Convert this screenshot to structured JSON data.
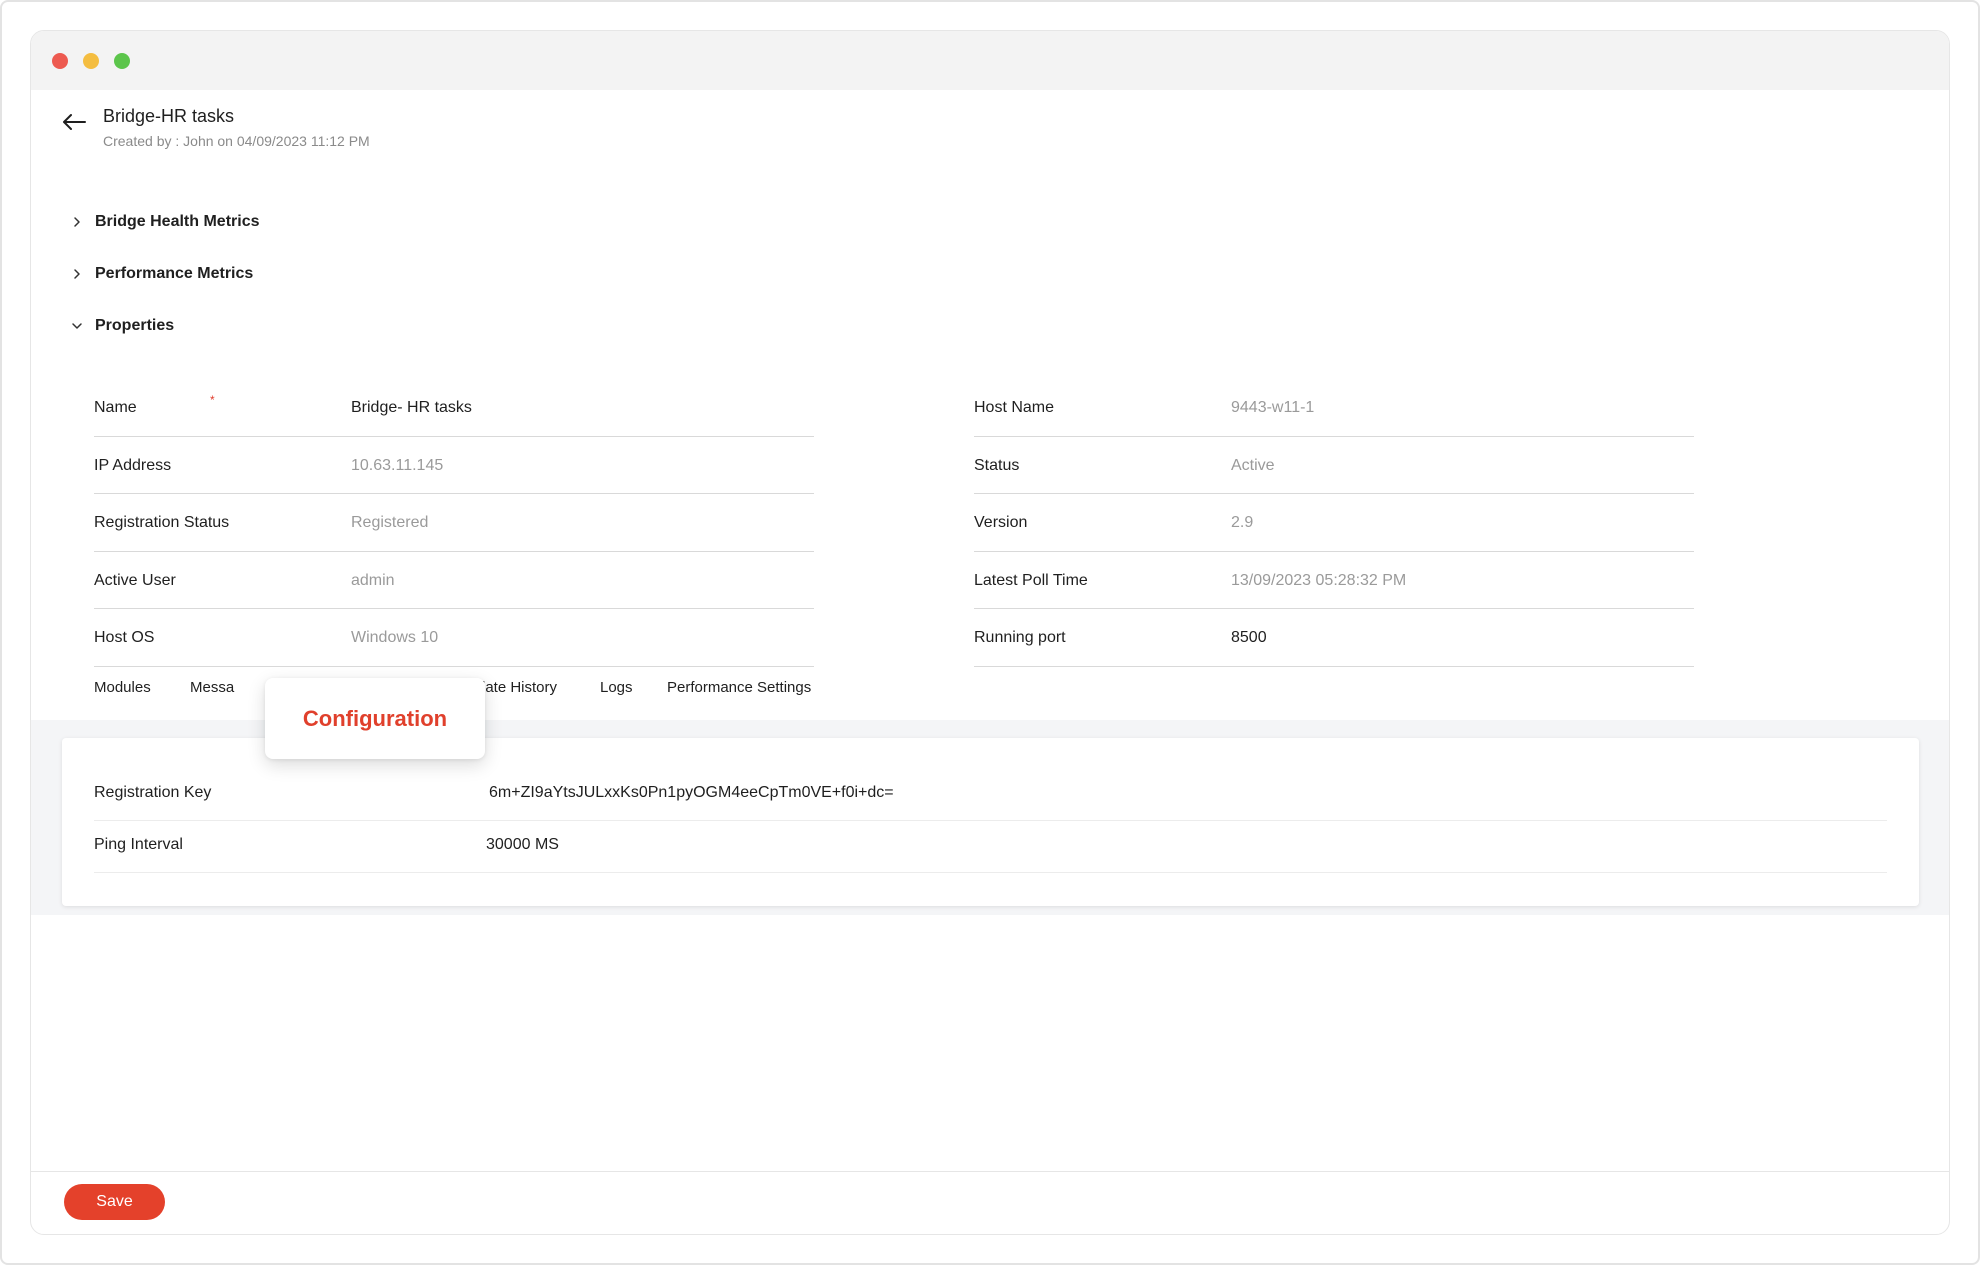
{
  "colors": {
    "accent": "#e4412b",
    "required": "#e03c2c",
    "muted_text": "#9a9a9a"
  },
  "window": {
    "controls": [
      "close-dot",
      "minimize-dot",
      "maximize-dot"
    ]
  },
  "header": {
    "back_icon": "arrow-left-icon",
    "title": "Bridge-HR tasks",
    "subtitle": "Created by : John on 04/09/2023 11:12 PM"
  },
  "sections": [
    {
      "label": "Bridge Health Metrics",
      "expanded": false
    },
    {
      "label": "Performance Metrics",
      "expanded": false
    },
    {
      "label": "Properties",
      "expanded": true
    }
  ],
  "properties": {
    "left": [
      {
        "label": "Name",
        "value": "Bridge- HR tasks",
        "required": "*"
      },
      {
        "label": "IP Address",
        "value": "10.63.11.145"
      },
      {
        "label": "Registration Status",
        "value": "Registered"
      },
      {
        "label": "Active User",
        "value": "admin"
      },
      {
        "label": "Host OS",
        "value": "Windows 10"
      }
    ],
    "right": [
      {
        "label": "Host Name",
        "value": "9443-w11-1"
      },
      {
        "label": "Status",
        "value": "Active"
      },
      {
        "label": "Version",
        "value": "2.9"
      },
      {
        "label": "Latest Poll Time",
        "value": "13/09/2023 05:28:32 PM"
      },
      {
        "label": "Running port",
        "value": "8500"
      }
    ]
  },
  "tabs": {
    "items": [
      {
        "label": "Modules"
      },
      {
        "label": "Messa"
      },
      {
        "label": "late History"
      },
      {
        "label": "Logs"
      },
      {
        "label": "Performance Settings"
      }
    ],
    "active_label": "Configuration"
  },
  "configuration": {
    "rows": [
      {
        "label": "Registration Key",
        "value": "6m+ZI9aYtsJULxxKs0Pn1pyOGM4eeCpTm0VE+f0i+dc="
      },
      {
        "label": "Ping Interval",
        "value": "30000 MS"
      }
    ]
  },
  "footer": {
    "save_label": "Save"
  }
}
